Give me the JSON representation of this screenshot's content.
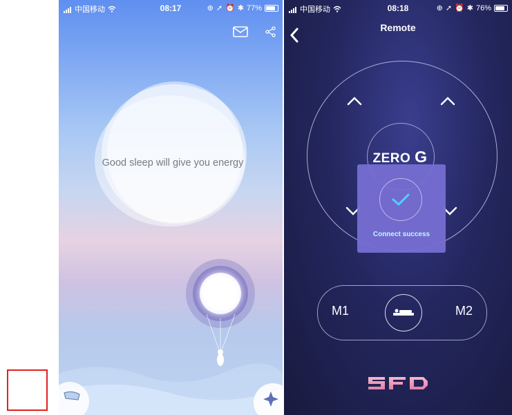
{
  "left_screen": {
    "status_bar": {
      "carrier": "中国移动",
      "time": "08:17",
      "battery": "77%",
      "battery_level": 0.77
    },
    "header_icons": [
      "mail-icon",
      "share-icon"
    ],
    "cloud_text": "Good sleep will give you energy"
  },
  "right_screen": {
    "status_bar": {
      "carrier": "中国移动",
      "time": "08:18",
      "battery": "76%",
      "battery_level": 0.76
    },
    "title": "Remote",
    "center_label": {
      "prefix": "ZERO",
      "suffix": "G"
    },
    "toast": "Connect success",
    "memory": {
      "left": "M1",
      "right": "M2"
    },
    "brand_logo": "SFD"
  },
  "colors": {
    "left_sky": "#7ea8f3",
    "right_bg": "#24275f",
    "toast": "#766ed2",
    "toast_text": "#c7f3ff",
    "check": "#4fd2ff",
    "annotation_box": "#e0201e"
  }
}
